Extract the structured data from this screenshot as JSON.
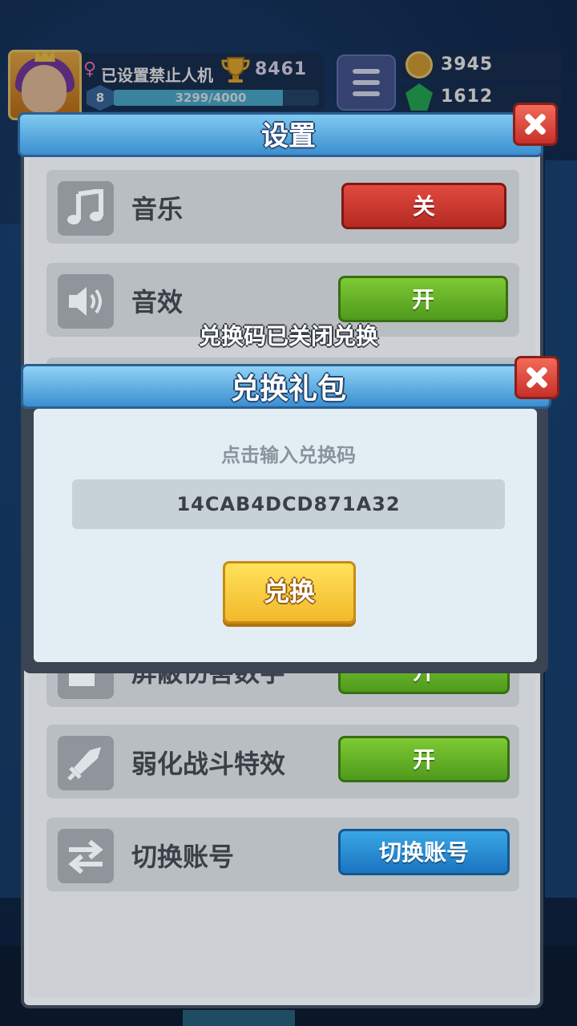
{
  "hud": {
    "nickname": "已设置禁止人机",
    "gender_symbol": "♀",
    "trophies": "8461",
    "level": "8",
    "xp_text": "3299/4000",
    "xp_progress": 0.8248,
    "coins": "3945",
    "gems": "1612"
  },
  "settings": {
    "title": "设置",
    "rows": [
      {
        "label": "音乐",
        "toggle": "关",
        "icon": "music-note-icon",
        "toggle_color": "#d13a30"
      },
      {
        "label": "音效",
        "toggle": "开",
        "icon": "speaker-icon",
        "toggle_color": "#66b22a"
      },
      {
        "label": "屏蔽伤害数字",
        "toggle": "开",
        "icon": "edit-icon",
        "toggle_color": "#66b22a"
      },
      {
        "label": "弱化战斗特效",
        "toggle": "开",
        "icon": "sword-icon",
        "toggle_color": "#66b22a"
      },
      {
        "label": "切换账号",
        "toggle": "切换账号",
        "icon": "switch-arrows-icon",
        "toggle_color": "#2a8cd6"
      }
    ]
  },
  "notice": "兑换码已关闭兑换",
  "redeem_dialog": {
    "title": "兑换礼包",
    "hint": "点击输入兑换码",
    "code": "14CAB4DCD871A32",
    "button": "兑换"
  }
}
